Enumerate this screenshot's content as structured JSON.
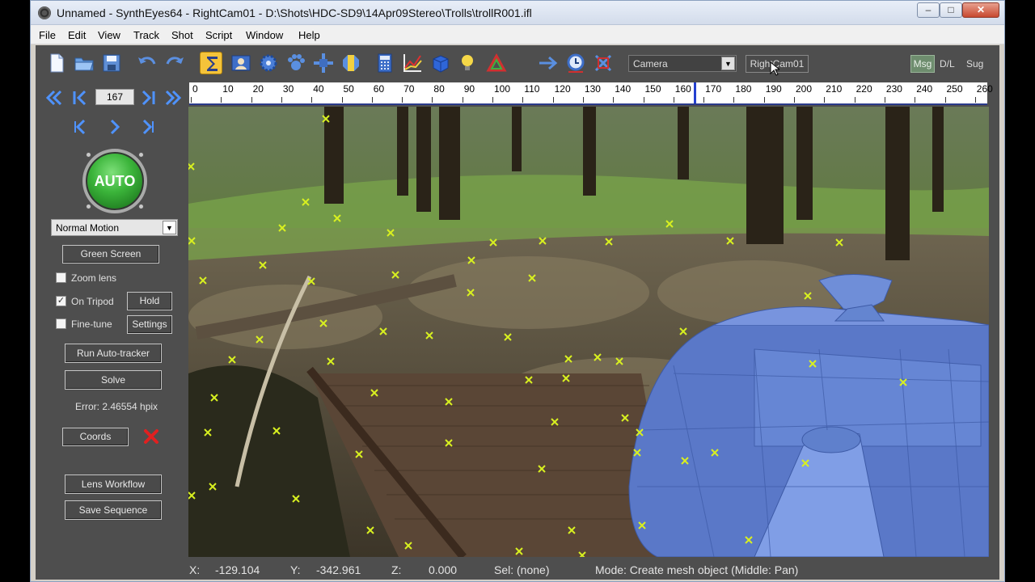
{
  "window": {
    "title": "Unnamed - SynthEyes64 - RightCam01 - D:\\Shots\\HDC-SD9\\14Apr09Stereo\\Trolls\\trollR001.ifl",
    "minimize": "–",
    "maximize": "□",
    "close": "✕"
  },
  "menu": [
    "File",
    "Edit",
    "View",
    "Track",
    "Shot",
    "Script",
    "Window",
    "Help"
  ],
  "toolbar": {
    "icons": [
      "new-file",
      "open-folder",
      "save",
      "undo",
      "redo",
      "solver-sigma",
      "camera-view",
      "gear",
      "paw",
      "move-gizmo",
      "lens",
      "calculator",
      "graph",
      "cube",
      "lightbulb",
      "color-wheel",
      "arrow-right",
      "clock",
      "crop-frame"
    ],
    "camera_select": "Camera",
    "camera_name_button": "RightCam01",
    "msg_button": "Msg",
    "dl_button": "D/L",
    "sug_button": "Sug",
    "accent_color": "#f4c33a"
  },
  "timeline": {
    "labels": [
      "0",
      "10",
      "20",
      "30",
      "40",
      "50",
      "60",
      "70",
      "80",
      "90",
      "100",
      "110",
      "120",
      "130",
      "140",
      "150",
      "160",
      "170",
      "180",
      "190",
      "200",
      "210",
      "220",
      "230",
      "240",
      "250",
      "260"
    ],
    "current_frame": 167,
    "last_frame": 262
  },
  "left_panel": {
    "frame_number": "167",
    "auto_button": "AUTO",
    "motion_select": "Normal Motion",
    "green_screen": "Green Screen",
    "zoom_lens": {
      "label": "Zoom lens",
      "checked": false
    },
    "on_tripod": {
      "label": "On Tripod",
      "checked": true
    },
    "hold": "Hold",
    "fine_tune": {
      "label": "Fine-tune",
      "checked": false
    },
    "settings": "Settings",
    "run_autotracker": "Run Auto-tracker",
    "solve": "Solve",
    "error": "Error: 2.46554 hpix",
    "coords": "Coords",
    "lens_workflow": "Lens Workflow",
    "save_sequence": "Save Sequence"
  },
  "status_bar": {
    "x_label": "X:",
    "x_value": "-129.104",
    "y_label": "Y:",
    "y_value": "-342.961",
    "z_label": "Z:",
    "z_value": "0.000",
    "sel": "Sel: (none)",
    "mode": "Mode: Create mesh object (Middle: Pan)"
  },
  "tracker_color": "#d8f020",
  "mesh_color": "#5a78c8"
}
